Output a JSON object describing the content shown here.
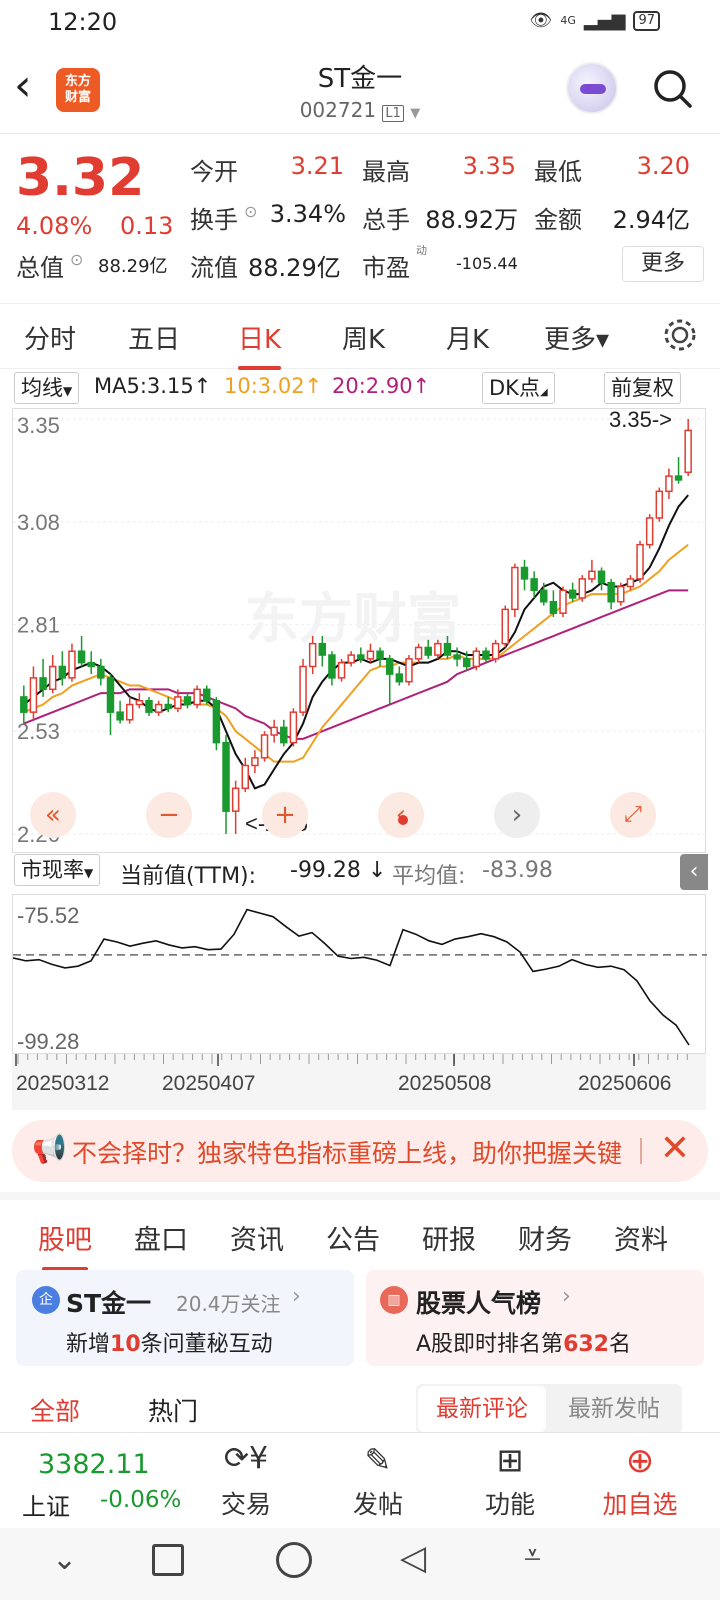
{
  "status": {
    "time": "12:20",
    "battery": "97",
    "network": "4G"
  },
  "header": {
    "logo": "东方\n财富",
    "name": "ST金一",
    "code": "002721",
    "level": "L1"
  },
  "quote": {
    "price": "3.32",
    "pct": "4.08%",
    "change": "0.13",
    "open_label": "今开",
    "open": "3.21",
    "high_label": "最高",
    "high": "3.35",
    "low_label": "最低",
    "low": "3.20",
    "turnover_label": "换手",
    "turnover": "3.34%",
    "volume_label": "总手",
    "volume": "88.92万",
    "amount_label": "金额",
    "amount": "2.94亿",
    "mktcap_label": "总值",
    "mktcap": "88.29亿",
    "float_label": "流值",
    "float": "88.29亿",
    "pe_label": "市盈",
    "pe_sup": "动",
    "pe": "-105.44",
    "more": "更多"
  },
  "tabs": [
    {
      "label": "分时"
    },
    {
      "label": "五日"
    },
    {
      "label": "日K"
    },
    {
      "label": "周K"
    },
    {
      "label": "月K"
    },
    {
      "label": "更多▾"
    }
  ],
  "ma_legend": {
    "btn": "均线",
    "ma5": "MA5:3.15↑",
    "ma10": "10:3.02↑",
    "ma20": "20:2.90↑",
    "dk": "DK点",
    "fq": "前复权",
    "c5": "#111111",
    "c10": "#f0a020",
    "c20": "#b0207a"
  },
  "chart_data": {
    "type": "candlestick",
    "ylim": [
      2.26,
      3.35
    ],
    "y_ticks": [
      "3.35",
      "3.08",
      "2.81",
      "2.53",
      "2.26"
    ],
    "max_label": "3.35->",
    "min_label": "<-2.26",
    "watermark": "东方财富",
    "x_ticks": [
      "20250312",
      "20250407",
      "20250508",
      "20250606"
    ],
    "up_color": "#e03c31",
    "down_color": "#1a9a2e",
    "candles": [
      [
        2.62,
        2.58,
        2.65,
        2.55
      ],
      [
        2.58,
        2.67,
        2.7,
        2.56
      ],
      [
        2.67,
        2.64,
        2.72,
        2.62
      ],
      [
        2.64,
        2.7,
        2.73,
        2.63
      ],
      [
        2.7,
        2.67,
        2.74,
        2.65
      ],
      [
        2.67,
        2.74,
        2.76,
        2.66
      ],
      [
        2.74,
        2.71,
        2.78,
        2.7
      ],
      [
        2.71,
        2.7,
        2.74,
        2.68
      ],
      [
        2.7,
        2.67,
        2.72,
        2.65
      ],
      [
        2.67,
        2.58,
        2.68,
        2.52
      ],
      [
        2.58,
        2.56,
        2.61,
        2.55
      ],
      [
        2.56,
        2.6,
        2.62,
        2.55
      ],
      [
        2.6,
        2.61,
        2.63,
        2.59
      ],
      [
        2.61,
        2.58,
        2.62,
        2.57
      ],
      [
        2.58,
        2.6,
        2.61,
        2.57
      ],
      [
        2.6,
        2.59,
        2.62,
        2.58
      ],
      [
        2.59,
        2.62,
        2.64,
        2.58
      ],
      [
        2.62,
        2.6,
        2.63,
        2.59
      ],
      [
        2.6,
        2.64,
        2.65,
        2.59
      ],
      [
        2.64,
        2.61,
        2.65,
        2.6
      ],
      [
        2.61,
        2.5,
        2.62,
        2.48
      ],
      [
        2.5,
        2.32,
        2.52,
        2.26
      ],
      [
        2.32,
        2.38,
        2.4,
        2.26
      ],
      [
        2.38,
        2.44,
        2.46,
        2.37
      ],
      [
        2.44,
        2.46,
        2.48,
        2.42
      ],
      [
        2.46,
        2.52,
        2.53,
        2.45
      ],
      [
        2.52,
        2.54,
        2.56,
        2.5
      ],
      [
        2.54,
        2.5,
        2.56,
        2.49
      ],
      [
        2.5,
        2.58,
        2.59,
        2.49
      ],
      [
        2.58,
        2.7,
        2.72,
        2.57
      ],
      [
        2.7,
        2.76,
        2.78,
        2.68
      ],
      [
        2.76,
        2.73,
        2.78,
        2.7
      ],
      [
        2.73,
        2.67,
        2.74,
        2.65
      ],
      [
        2.67,
        2.71,
        2.72,
        2.66
      ],
      [
        2.71,
        2.73,
        2.74,
        2.7
      ],
      [
        2.73,
        2.72,
        2.75,
        2.71
      ],
      [
        2.72,
        2.74,
        2.76,
        2.71
      ],
      [
        2.74,
        2.72,
        2.75,
        2.7
      ],
      [
        2.72,
        2.68,
        2.73,
        2.6
      ],
      [
        2.68,
        2.66,
        2.7,
        2.65
      ],
      [
        2.66,
        2.72,
        2.73,
        2.65
      ],
      [
        2.72,
        2.75,
        2.76,
        2.71
      ],
      [
        2.75,
        2.73,
        2.77,
        2.72
      ],
      [
        2.73,
        2.76,
        2.77,
        2.72
      ],
      [
        2.76,
        2.73,
        2.78,
        2.72
      ],
      [
        2.73,
        2.72,
        2.75,
        2.7
      ],
      [
        2.72,
        2.7,
        2.74,
        2.69
      ],
      [
        2.7,
        2.74,
        2.75,
        2.69
      ],
      [
        2.74,
        2.72,
        2.75,
        2.71
      ],
      [
        2.72,
        2.76,
        2.77,
        2.71
      ],
      [
        2.76,
        2.85,
        2.86,
        2.75
      ],
      [
        2.85,
        2.96,
        2.97,
        2.83
      ],
      [
        2.96,
        2.93,
        2.98,
        2.9
      ],
      [
        2.93,
        2.9,
        2.95,
        2.88
      ],
      [
        2.9,
        2.87,
        2.92,
        2.86
      ],
      [
        2.87,
        2.84,
        2.9,
        2.83
      ],
      [
        2.84,
        2.9,
        2.91,
        2.83
      ],
      [
        2.9,
        2.88,
        2.92,
        2.87
      ],
      [
        2.88,
        2.93,
        2.94,
        2.87
      ],
      [
        2.93,
        2.95,
        2.98,
        2.92
      ],
      [
        2.95,
        2.92,
        2.96,
        2.9
      ],
      [
        2.92,
        2.87,
        2.93,
        2.85
      ],
      [
        2.87,
        2.91,
        2.92,
        2.86
      ],
      [
        2.91,
        2.93,
        2.94,
        2.9
      ],
      [
        2.93,
        3.02,
        3.03,
        2.92
      ],
      [
        3.02,
        3.09,
        3.1,
        3.01
      ],
      [
        3.09,
        3.16,
        3.17,
        3.08
      ],
      [
        3.16,
        3.2,
        3.22,
        3.14
      ],
      [
        3.2,
        3.19,
        3.25,
        3.18
      ],
      [
        3.21,
        3.32,
        3.35,
        3.2
      ]
    ],
    "ma5": [
      2.6,
      2.62,
      2.64,
      2.66,
      2.67,
      2.69,
      2.7,
      2.71,
      2.7,
      2.68,
      2.65,
      2.62,
      2.61,
      2.59,
      2.58,
      2.59,
      2.6,
      2.6,
      2.61,
      2.61,
      2.59,
      2.53,
      2.47,
      2.43,
      2.38,
      2.39,
      2.43,
      2.47,
      2.5,
      2.55,
      2.62,
      2.66,
      2.69,
      2.71,
      2.71,
      2.72,
      2.71,
      2.72,
      2.72,
      2.71,
      2.7,
      2.71,
      2.71,
      2.72,
      2.74,
      2.74,
      2.73,
      2.73,
      2.73,
      2.73,
      2.75,
      2.79,
      2.85,
      2.88,
      2.91,
      2.92,
      2.9,
      2.89,
      2.89,
      2.9,
      2.92,
      2.91,
      2.91,
      2.92,
      2.93,
      2.96,
      3.01,
      3.07,
      3.12,
      3.15
    ],
    "ma10": [
      2.58,
      2.59,
      2.6,
      2.62,
      2.63,
      2.65,
      2.66,
      2.67,
      2.68,
      2.67,
      2.66,
      2.65,
      2.65,
      2.64,
      2.63,
      2.62,
      2.61,
      2.61,
      2.6,
      2.6,
      2.59,
      2.57,
      2.53,
      2.51,
      2.49,
      2.47,
      2.45,
      2.45,
      2.45,
      2.46,
      2.5,
      2.54,
      2.57,
      2.6,
      2.63,
      2.66,
      2.69,
      2.7,
      2.7,
      2.71,
      2.71,
      2.71,
      2.71,
      2.72,
      2.72,
      2.73,
      2.72,
      2.72,
      2.72,
      2.72,
      2.74,
      2.76,
      2.78,
      2.8,
      2.82,
      2.84,
      2.86,
      2.87,
      2.88,
      2.89,
      2.89,
      2.89,
      2.89,
      2.9,
      2.91,
      2.93,
      2.95,
      2.98,
      3.0,
      3.02
    ],
    "ma20": [
      2.55,
      2.56,
      2.57,
      2.58,
      2.59,
      2.6,
      2.61,
      2.62,
      2.63,
      2.63,
      2.63,
      2.64,
      2.64,
      2.64,
      2.64,
      2.64,
      2.63,
      2.63,
      2.63,
      2.62,
      2.61,
      2.6,
      2.59,
      2.57,
      2.56,
      2.55,
      2.53,
      2.52,
      2.51,
      2.51,
      2.52,
      2.53,
      2.54,
      2.55,
      2.56,
      2.57,
      2.58,
      2.59,
      2.6,
      2.61,
      2.62,
      2.63,
      2.64,
      2.65,
      2.66,
      2.68,
      2.69,
      2.7,
      2.71,
      2.72,
      2.73,
      2.74,
      2.75,
      2.76,
      2.77,
      2.78,
      2.79,
      2.8,
      2.81,
      2.82,
      2.83,
      2.84,
      2.85,
      2.86,
      2.87,
      2.88,
      2.89,
      2.9,
      2.9,
      2.9
    ]
  },
  "pe_legend": {
    "btn": "市现率",
    "label": "当前值(TTM):",
    "current": "-99.28",
    "arrow": "↓",
    "avg_label": "平均值:",
    "avg": "-83.98"
  },
  "pe_chart": {
    "top_label": "-75.52",
    "bottom_label": "-99.28",
    "avg": -83.98,
    "ylim": [
      -99.28,
      -75.52
    ],
    "series": [
      -84.5,
      -85.0,
      -84.8,
      -85.6,
      -86.2,
      -85.9,
      -85.0,
      -81.3,
      -81.8,
      -82.5,
      -82.0,
      -81.6,
      -82.3,
      -82.8,
      -82.6,
      -83.1,
      -83.0,
      -80.5,
      -76.3,
      -76.9,
      -77.5,
      -79.2,
      -80.8,
      -80.2,
      -82.1,
      -84.2,
      -84.6,
      -84.4,
      -84.9,
      -85.8,
      -79.7,
      -80.5,
      -81.6,
      -82.2,
      -81.3,
      -80.9,
      -80.4,
      -80.9,
      -81.8,
      -83.5,
      -86.8,
      -86.4,
      -85.9,
      -84.8,
      -85.6,
      -86.1,
      -85.9,
      -86.5,
      -88.4,
      -91.8,
      -94.2,
      -95.9,
      -99.28
    ]
  },
  "banner": {
    "text": "不会择时？独家特色指标重磅上线，助你把握关键"
  },
  "sec_tabs": [
    "股吧",
    "盘口",
    "资讯",
    "公告",
    "研报",
    "财务",
    "资料"
  ],
  "card1": {
    "badge": "企",
    "title": "ST金一",
    "follow": "20.4万关注",
    "line_pre": "新增",
    "line_num": "10",
    "line_post": "条问董秘互动"
  },
  "card2": {
    "title": "股票人气榜",
    "line_pre": "A股即时排名第",
    "line_num": "632",
    "line_post": "名"
  },
  "filters": {
    "all": "全部",
    "hot": "热门",
    "latest_comment": "最新评论",
    "latest_post": "最新发帖"
  },
  "bottom": {
    "index_val": "3382.11",
    "index_name": "上证",
    "index_chg": "-0.06%",
    "trade": "交易",
    "post": "发帖",
    "func": "功能",
    "add": "加自选"
  }
}
